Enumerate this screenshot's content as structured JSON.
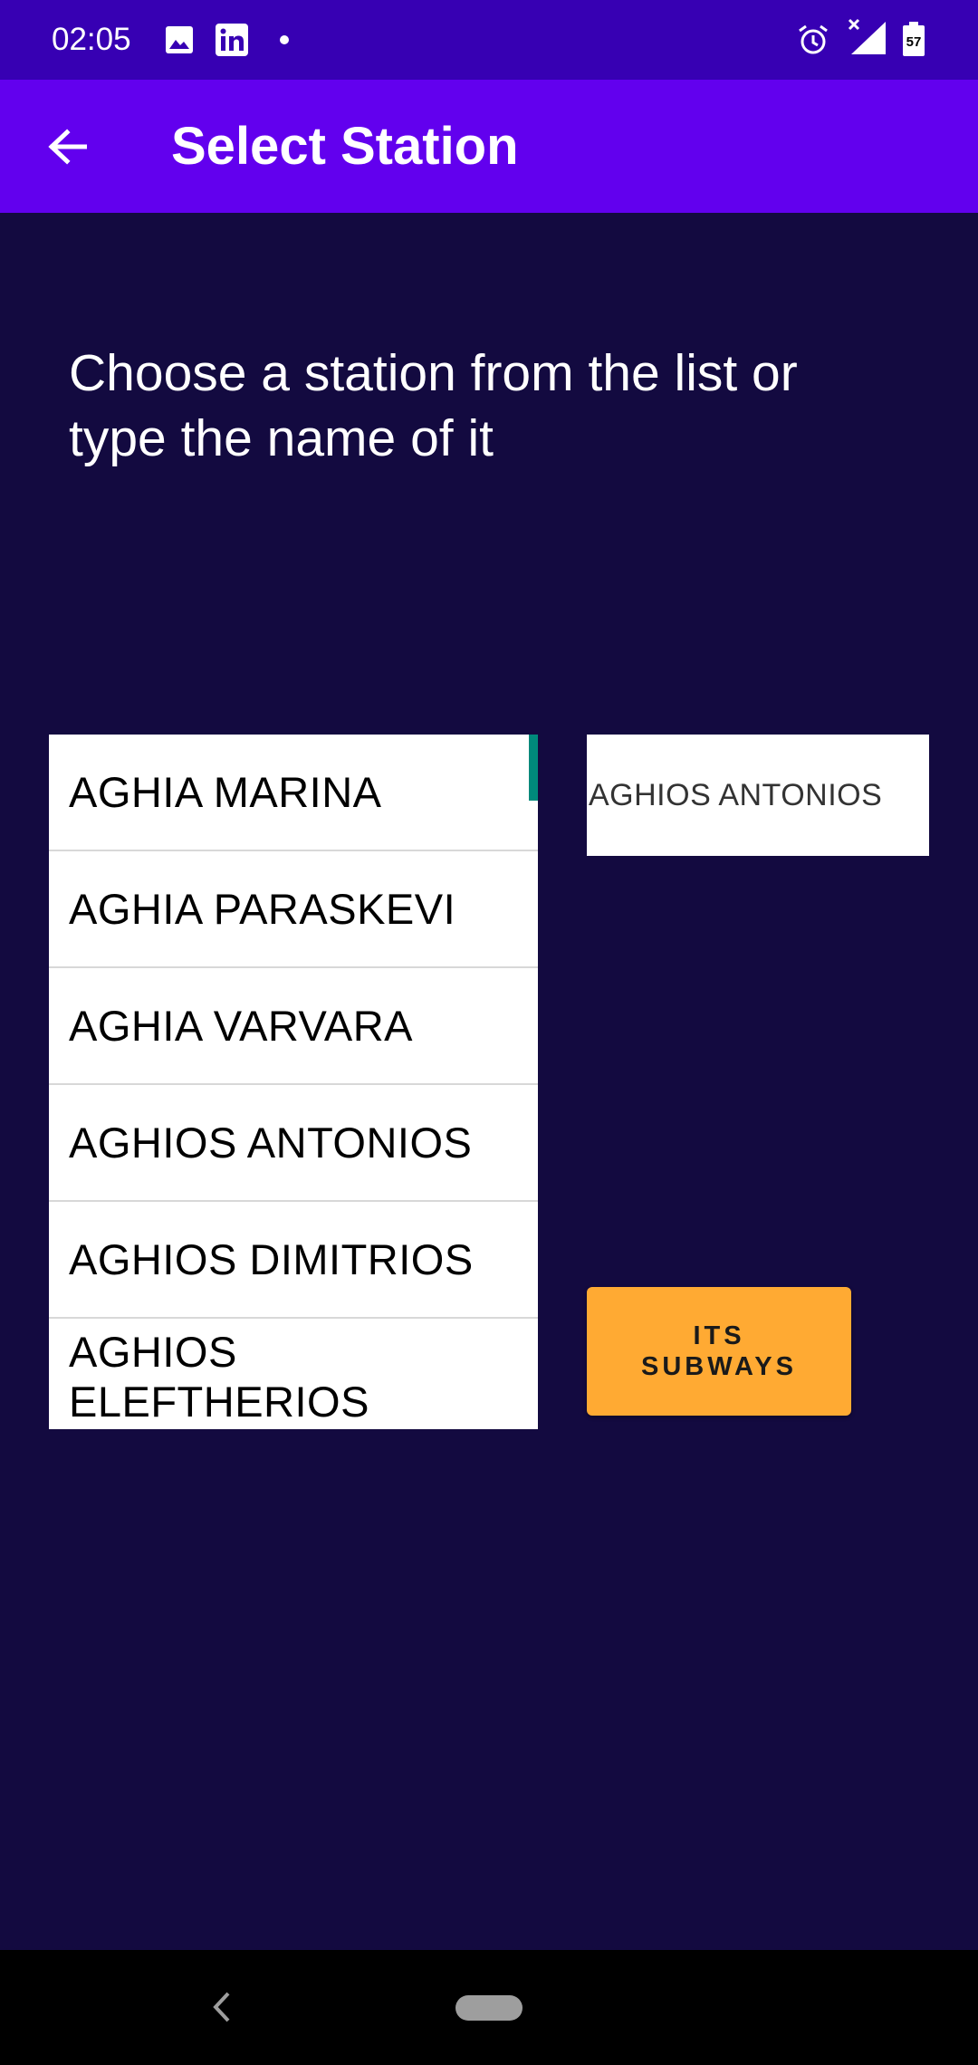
{
  "status_bar": {
    "time": "02:05",
    "left_icons": [
      "image-icon",
      "linkedin-icon",
      "dot-icon"
    ],
    "right_icons": [
      "alarm-icon",
      "signal-icon",
      "battery-icon"
    ],
    "battery_level": "57"
  },
  "app_bar": {
    "back_icon": "arrow-left-icon",
    "title": "Select Station"
  },
  "instruction": "Choose a station from the list or type the name of it",
  "station_list": {
    "items": [
      "AGHIA MARINA",
      "AGHIA PARASKEVI",
      "AGHIA VARVARA",
      "AGHIOS ANTONIOS",
      "AGHIOS DIMITRIOS",
      "AGHIOS ELEFTHERIOS"
    ]
  },
  "search": {
    "value": "AGHIOS ANTONIOS"
  },
  "action_button": {
    "line1": "ITS",
    "line2": "SUBWAYS"
  },
  "colors": {
    "status_bar": "#3700b3",
    "app_bar": "#6200ee",
    "background": "#130a40",
    "button": "#ffaa33",
    "scroll_accent": "#00897b"
  }
}
